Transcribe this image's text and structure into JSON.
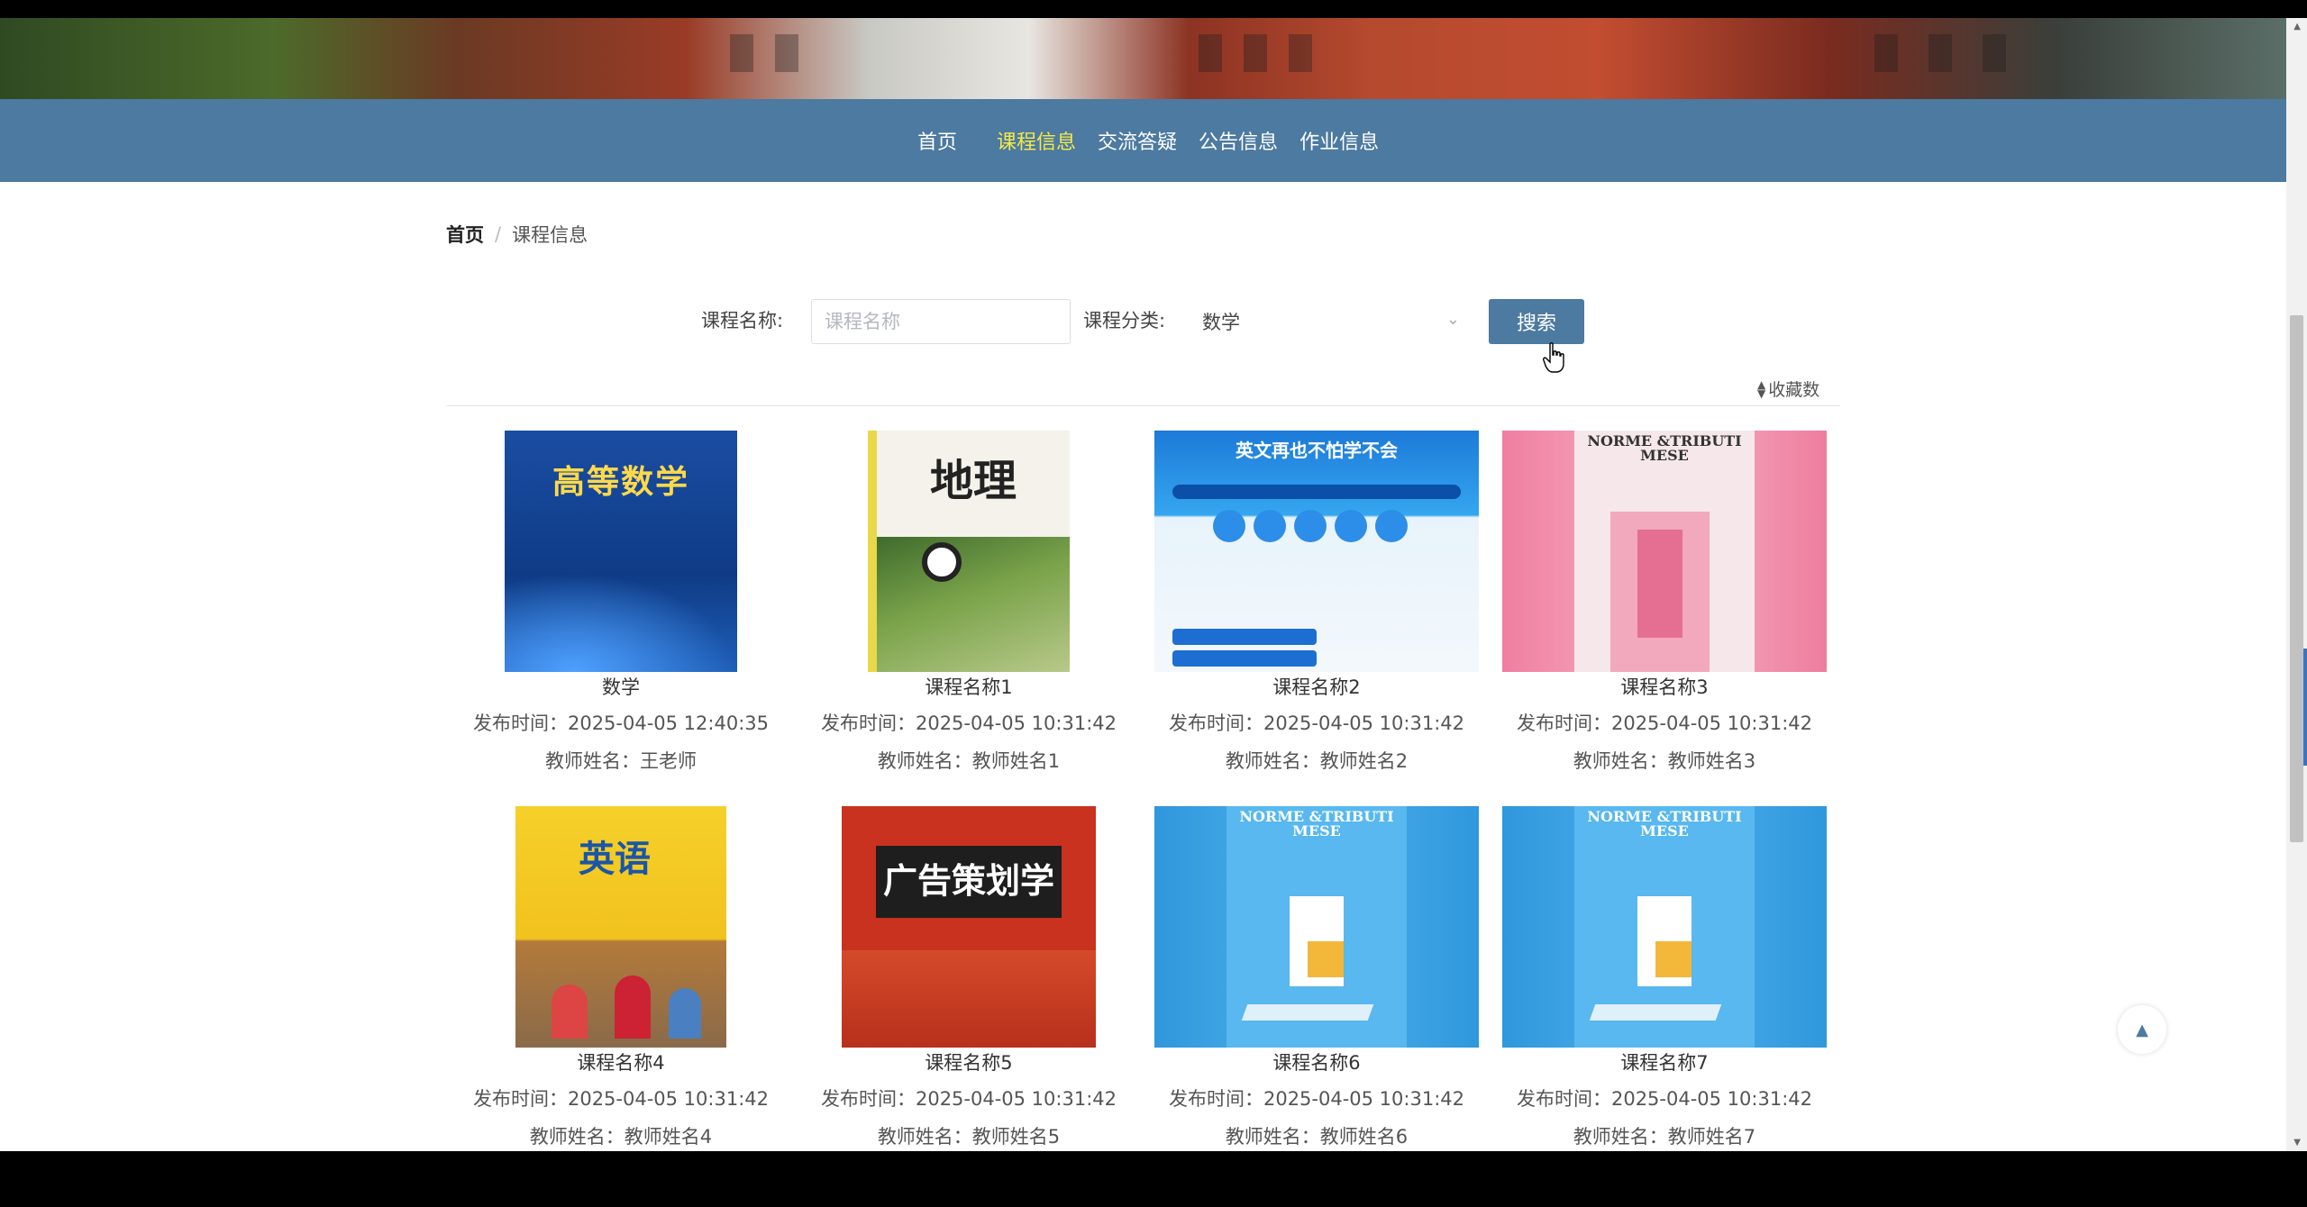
{
  "nav": {
    "items": [
      "首页",
      "课程信息",
      "交流答疑",
      "公告信息",
      "作业信息"
    ],
    "active_index": 1
  },
  "breadcrumb": {
    "home": "首页",
    "separator": "/",
    "current": "课程信息"
  },
  "search": {
    "name_label": "课程名称:",
    "name_placeholder": "课程名称",
    "category_label": "课程分类:",
    "category_value": "数学",
    "button_label": "搜索"
  },
  "sort": {
    "label": "收藏数"
  },
  "courses": [
    {
      "name": "数学",
      "publish": "发布时间：2025-04-05 12:40:35",
      "teacher": "教师姓名：王老师",
      "cover_text": "高等数学",
      "cover_color": "#1c4fa0"
    },
    {
      "name": "课程名称1",
      "publish": "发布时间：2025-04-05 10:31:42",
      "teacher": "教师姓名：教师姓名1",
      "cover_text": "地理",
      "cover_color": "#f3f1e8"
    },
    {
      "name": "课程名称2",
      "publish": "发布时间：2025-04-05 10:31:42",
      "teacher": "教师姓名：教师姓名2",
      "cover_text": "英文再也不怕学不会",
      "cover_color": "#1f7fd6"
    },
    {
      "name": "课程名称3",
      "publish": "发布时间：2025-04-05 10:31:42",
      "teacher": "教师姓名：教师姓名3",
      "cover_text": "NORME &TRIBUTI MESE",
      "cover_color": "#e98aa6"
    },
    {
      "name": "课程名称4",
      "publish": "发布时间：2025-04-05 10:31:42",
      "teacher": "教师姓名：教师姓名4",
      "cover_text": "英语",
      "cover_color": "#f0c224"
    },
    {
      "name": "课程名称5",
      "publish": "发布时间：2025-04-05 10:31:42",
      "teacher": "教师姓名：教师姓名5",
      "cover_text": "广告策划学",
      "cover_color": "#c8321f"
    },
    {
      "name": "课程名称6",
      "publish": "发布时间：2025-04-05 10:31:42",
      "teacher": "教师姓名：教师姓名6",
      "cover_text": "NORME &TRIBUTI MESE",
      "cover_color": "#3fa3e0"
    },
    {
      "name": "课程名称7",
      "publish": "发布时间：2025-04-05 10:31:42",
      "teacher": "教师姓名：教师姓名7",
      "cover_text": "NORME &TRIBUTI MESE",
      "cover_color": "#3fa3e0"
    }
  ],
  "icons": {
    "sort": "sort-arrows-icon",
    "to_top": "arrow-up-icon",
    "select": "chevron-down-icon"
  }
}
